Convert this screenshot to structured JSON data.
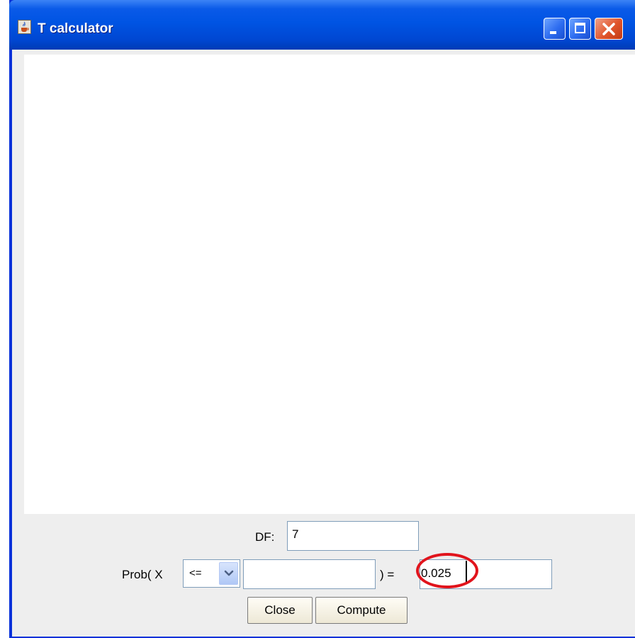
{
  "window": {
    "title": "T calculator",
    "icon": "java-cup-icon",
    "controls": [
      "minimize",
      "maximize",
      "close"
    ]
  },
  "form": {
    "df_label": "DF:",
    "df_value": "7",
    "prob_label": "Prob( X",
    "operator_value": "<=",
    "x_value": "",
    "equals_label": ") =",
    "prob_value": "0.025"
  },
  "buttons": {
    "close_label": "Close",
    "compute_label": "Compute"
  },
  "colors": {
    "titlebar": "#0054e3",
    "annotation": "#e1141c"
  }
}
